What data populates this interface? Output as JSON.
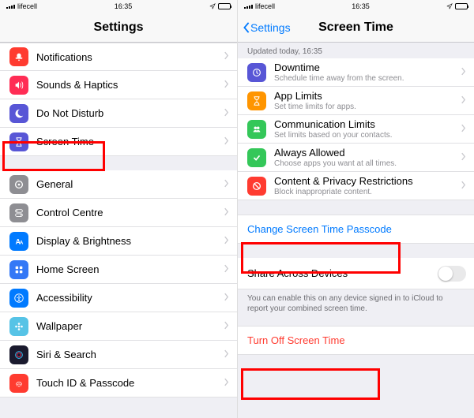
{
  "status": {
    "carrier": "lifecell",
    "time": "16:35"
  },
  "left": {
    "title": "Settings",
    "group1": [
      {
        "label": "Notifications",
        "color": "#ff3b30",
        "icon": "bell"
      },
      {
        "label": "Sounds & Haptics",
        "color": "#ff2d55",
        "icon": "sound"
      },
      {
        "label": "Do Not Disturb",
        "color": "#5856d6",
        "icon": "moon"
      },
      {
        "label": "Screen Time",
        "color": "#5856d6",
        "icon": "hourglass"
      }
    ],
    "group2": [
      {
        "label": "General",
        "color": "#8e8e93",
        "icon": "gear"
      },
      {
        "label": "Control Centre",
        "color": "#8e8e93",
        "icon": "switches"
      },
      {
        "label": "Display & Brightness",
        "color": "#007aff",
        "icon": "text"
      },
      {
        "label": "Home Screen",
        "color": "#3478f6",
        "icon": "grid"
      },
      {
        "label": "Accessibility",
        "color": "#007aff",
        "icon": "person"
      },
      {
        "label": "Wallpaper",
        "color": "#56c3e6",
        "icon": "flower"
      },
      {
        "label": "Siri & Search",
        "color": "#1a1a2e",
        "icon": "siri"
      },
      {
        "label": "Touch ID & Passcode",
        "color": "#ff3b30",
        "icon": "fingerprint"
      }
    ]
  },
  "right": {
    "back": "Settings",
    "title": "Screen Time",
    "updated": "Updated today, 16:35",
    "rows": [
      {
        "label": "Downtime",
        "sub": "Schedule time away from the screen.",
        "color": "#5856d6",
        "icon": "downtime"
      },
      {
        "label": "App Limits",
        "sub": "Set time limits for apps.",
        "color": "#ff9500",
        "icon": "hourglass"
      },
      {
        "label": "Communication Limits",
        "sub": "Set limits based on your contacts.",
        "color": "#34c759",
        "icon": "people"
      },
      {
        "label": "Always Allowed",
        "sub": "Choose apps you want at all times.",
        "color": "#34c759",
        "icon": "check"
      },
      {
        "label": "Content & Privacy Restrictions",
        "sub": "Block inappropriate content.",
        "color": "#ff3b30",
        "icon": "nope"
      }
    ],
    "change_passcode": "Change Screen Time Passcode",
    "share_label": "Share Across Devices",
    "share_note": "You can enable this on any device signed in to iCloud to report your combined screen time.",
    "turn_off": "Turn Off Screen Time"
  }
}
